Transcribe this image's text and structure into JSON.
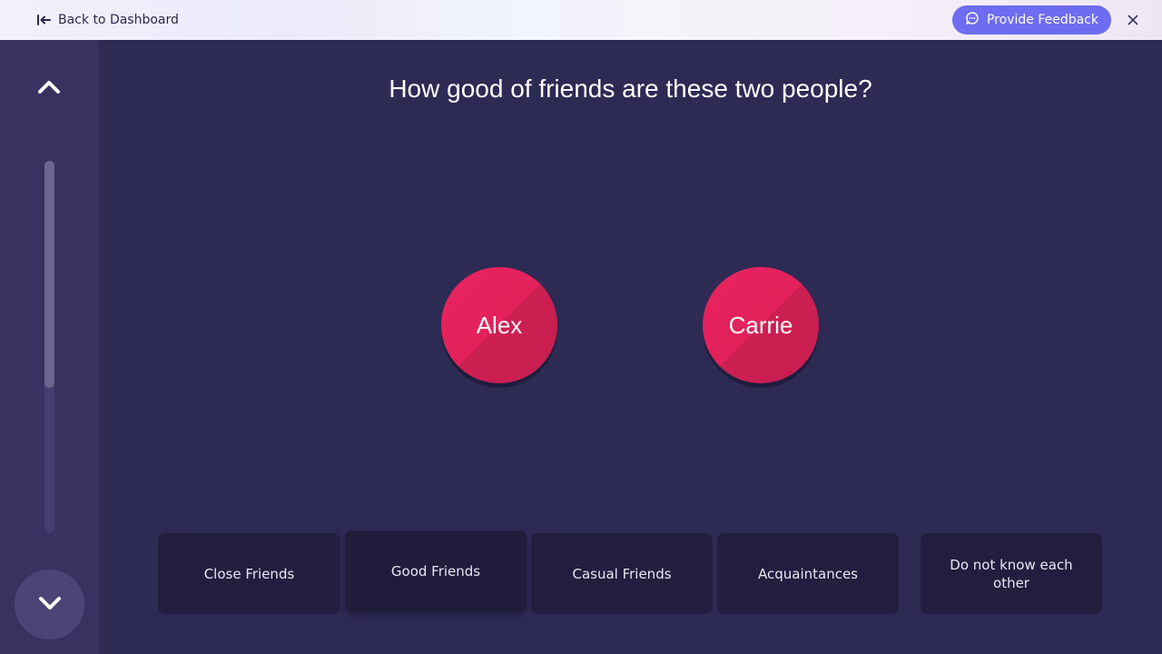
{
  "topbar": {
    "back_label": "Back to Dashboard",
    "feedback_label": "Provide Feedback",
    "accent_color": "#6e6cf0"
  },
  "sidebar": {
    "up_icon": "chevron-up-icon",
    "down_icon": "chevron-down-icon",
    "scroll_progress": 0.61
  },
  "question": {
    "text": "How good of friends are these two people?"
  },
  "people": [
    {
      "name": "Alex",
      "color": "#e3215c"
    },
    {
      "name": "Carrie",
      "color": "#e3215c"
    }
  ],
  "options": [
    {
      "label": "Close Friends"
    },
    {
      "label": "Good Friends"
    },
    {
      "label": "Casual Friends"
    },
    {
      "label": "Acquaintances"
    },
    {
      "label": "Do not know each other"
    }
  ]
}
